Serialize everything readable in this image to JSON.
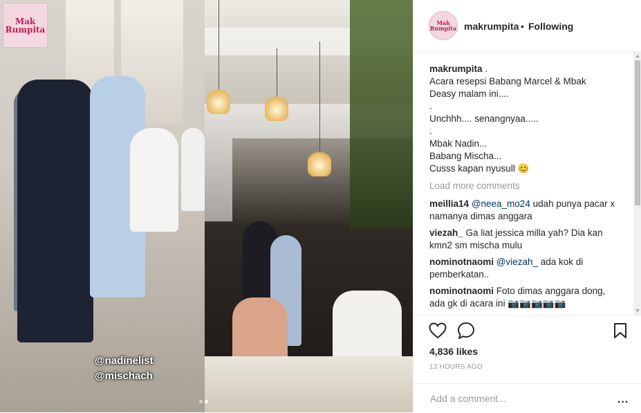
{
  "media": {
    "logo_line1": "Mak",
    "logo_line2": "Rumpita",
    "tags": [
      "@nadinelist",
      "@mischach"
    ]
  },
  "header": {
    "avatar_line1": "Mak",
    "avatar_line2": "Rumpita",
    "username": "makrumpita",
    "separator": "•",
    "follow_status": "Following"
  },
  "caption": {
    "username": "makrumpita",
    "suffix": " .",
    "lines": [
      "Acara resepsi Babang Marcel & Mbak",
      "Deasy malam ini....",
      ".",
      "Unchhh.... senangnyaa.....",
      ".",
      "Mbak Nadin...",
      "Babang Mischa...",
      "Cusss kapan nyusull 😊"
    ]
  },
  "load_more": "Load more comments",
  "comments": [
    {
      "user": "meillia14",
      "mention": "@neea_mo24",
      "text": " udah punya pacar x namanya dimas anggara"
    },
    {
      "user": "viezah_",
      "mention": "",
      "text": "Ga liat jessica milla yah? Dia kan kmn2 sm mischa mulu"
    },
    {
      "user": "nominotnaomi",
      "mention": "@viezah_",
      "text": " ada kok di pemberkatan.."
    },
    {
      "user": "nominotnaomi",
      "mention": "",
      "text": "Foto dimas anggara dong, ada gk di acara ini 📷📷📷📷📷"
    }
  ],
  "icons": {
    "like": "heart-icon",
    "comment": "comment-icon",
    "save": "bookmark-icon"
  },
  "likes": "4,836 likes",
  "timestamp": "13 HOURS AGO",
  "add_comment": {
    "placeholder": "Add a comment...",
    "more": "..."
  },
  "colors": {
    "mention": "#003569",
    "muted": "#999999",
    "text": "#262626",
    "border": "#efefef"
  }
}
